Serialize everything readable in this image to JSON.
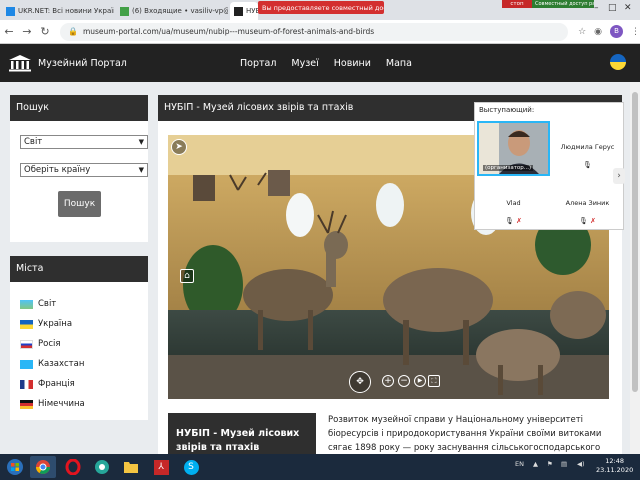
{
  "browser": {
    "tabs": [
      {
        "label": "UKR.NET: Всі новини України, о"
      },
      {
        "label": "(6) Входящие • vasiliv-vp@ukr.n"
      },
      {
        "label": "НУБ"
      }
    ],
    "share_banner": "Вы предоставляете совместный доступ к Go...",
    "stop_label": "стоп",
    "share_status": "Совместный доступ разрешён",
    "url": "museum-portal.com/ua/museum/nubip---museum-of-forest-animals-and-birds",
    "profile_letter": "В"
  },
  "site": {
    "logo_text": "Музейний Портал",
    "nav": [
      "Портал",
      "Музеї",
      "Новини",
      "Мапа"
    ]
  },
  "search_panel": {
    "title": "Пошук",
    "select1": "Світ",
    "select2": "Оберіть країну",
    "button": "Пошук"
  },
  "cities_panel": {
    "title": "Міста",
    "items": [
      {
        "label": "Світ",
        "flag": "world"
      },
      {
        "label": "Україна",
        "flag": "ua"
      },
      {
        "label": "Росія",
        "flag": "ru"
      },
      {
        "label": "Казахстан",
        "flag": "kz"
      },
      {
        "label": "Франція",
        "flag": "fr"
      },
      {
        "label": "Німеччина",
        "flag": "de"
      }
    ]
  },
  "main": {
    "title": "НУБІП - Музей лісових звірів та птахів",
    "info_title": "НУБІП - Музей лісових звірів та птахів",
    "description": "Розвиток музейної справи у Національному університеті біоресурсів і природокористування України своїми витоками сягає 1898 року — року заснування сільськогосподарського відділення при КПІ. При зоологічній"
  },
  "call": {
    "speaker_label": "Выступающий:",
    "organizer_label": "(организатор...)",
    "participants": [
      {
        "name": "Людмила Герус"
      },
      {
        "name": "Vlad"
      },
      {
        "name": "Алена Зиник"
      }
    ]
  },
  "taskbar": {
    "lang": "EN",
    "time": "12:48",
    "date": "23.11.2020"
  },
  "colors": {
    "header_dark": "#222222",
    "panel_head": "#2f2f2f",
    "share_red": "#d32f2f",
    "share_green": "#2e7d32"
  }
}
